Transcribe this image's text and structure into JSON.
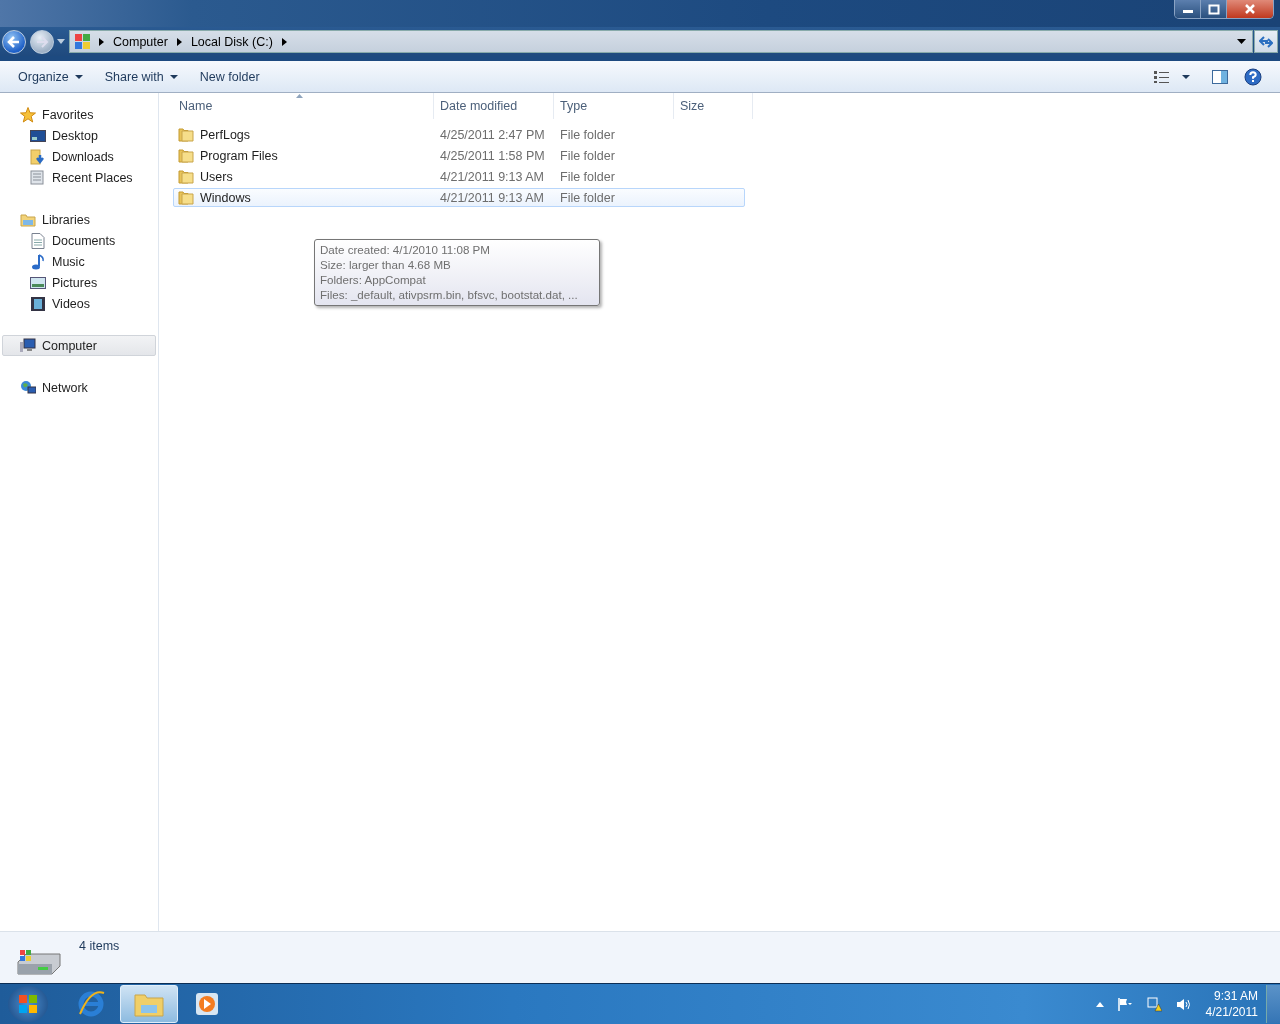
{
  "breadcrumb": [
    "Computer",
    "Local Disk (C:)"
  ],
  "toolbar": [
    {
      "label": "Organize",
      "dropdown": true
    },
    {
      "label": "Share with",
      "dropdown": true
    },
    {
      "label": "New folder",
      "dropdown": false
    }
  ],
  "sidebar": [
    {
      "label": "Favorites",
      "kind": "star",
      "selected": false,
      "children": [
        {
          "label": "Desktop",
          "kind": "desktop",
          "selected": false
        },
        {
          "label": "Downloads",
          "kind": "downloads",
          "selected": false
        },
        {
          "label": "Recent Places",
          "kind": "recent",
          "selected": false
        }
      ]
    },
    {
      "label": "Libraries",
      "kind": "library",
      "selected": false,
      "children": [
        {
          "label": "Documents",
          "kind": "document",
          "selected": false
        },
        {
          "label": "Music",
          "kind": "music",
          "selected": false
        },
        {
          "label": "Pictures",
          "kind": "picture",
          "selected": false
        },
        {
          "label": "Videos",
          "kind": "video",
          "selected": false
        }
      ]
    },
    {
      "label": "Computer",
      "kind": "computer",
      "selected": true
    },
    {
      "label": "Network",
      "kind": "network",
      "selected": false
    }
  ],
  "table": {
    "columns": [
      {
        "label": "Name",
        "sorted": true
      },
      {
        "label": "Date modified",
        "sorted": false
      },
      {
        "label": "Type",
        "sorted": false
      },
      {
        "label": "Size",
        "sorted": false
      }
    ],
    "rows": [
      {
        "name": "PerfLogs",
        "date": "4/25/2011 2:47 PM",
        "type": "File folder",
        "selected": false
      },
      {
        "name": "Program Files",
        "date": "4/25/2011 1:58 PM",
        "type": "File folder",
        "selected": false
      },
      {
        "name": "Users",
        "date": "4/21/2011 9:13 AM",
        "type": "File folder",
        "selected": false
      },
      {
        "name": "Windows",
        "date": "4/21/2011 9:13 AM",
        "type": "File folder",
        "selected": true
      }
    ]
  },
  "tooltip": [
    "Date created: 4/1/2010 11:08 PM",
    "Size: larger than 4.68 MB",
    "Folders: AppCompat",
    "Files: _default, ativpsrm.bin, bfsvc, bootstat.dat, ..."
  ],
  "status_bar": {
    "text": "4 items"
  },
  "taskbar": {
    "apps": [
      {
        "kind": "browser",
        "selected": false
      },
      {
        "kind": "explorer",
        "selected": true
      },
      {
        "kind": "media",
        "selected": false
      }
    ],
    "time": "9:31 AM",
    "date": "4/21/2011"
  }
}
